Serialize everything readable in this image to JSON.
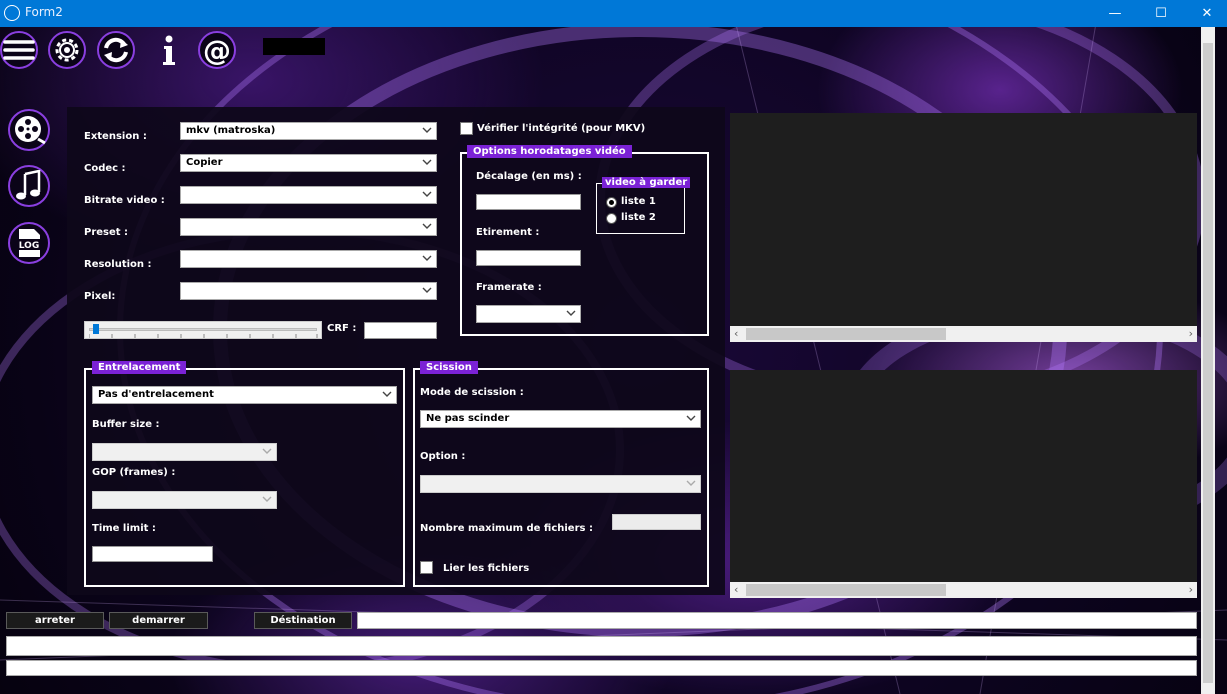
{
  "window": {
    "title": "Form2",
    "minimize": "—",
    "maximize": "☐",
    "close": "✕"
  },
  "toolbar": {
    "icons": [
      "menu-icon",
      "gear-icon",
      "refresh-icon",
      "info-icon",
      "at-icon"
    ]
  },
  "sidebar": {
    "icons": [
      "film-reel-icon",
      "music-note-icon",
      "log-icon"
    ],
    "log_text": "LOG"
  },
  "video": {
    "extension_label": "Extension :",
    "extension_value": "mkv (matroska)",
    "codec_label": "Codec :",
    "codec_value": "Copier",
    "bitrate_label": "Bitrate video :",
    "preset_label": "Preset :",
    "resolution_label": "Resolution :",
    "pixel_label": "Pixel:",
    "crf_label": "CRF :",
    "crf_slider_level": 0.02
  },
  "integrity": {
    "label": "Vérifier l'intégrité (pour MKV)",
    "checked": false
  },
  "timestamps": {
    "title": "Options horodatages vidéo",
    "offset_label": "Décalage (en ms) :",
    "stretch_label": "Etirement :",
    "framerate_label": "Framerate :",
    "keep": {
      "title": "video à garder",
      "options": [
        "liste 1",
        "liste 2"
      ],
      "selected": "liste 1"
    }
  },
  "interlace": {
    "title": "Entrelacement",
    "value": "Pas d'entrelacement",
    "buffer_label": "Buffer size :",
    "gop_label": "GOP (frames) :",
    "time_label": "Time limit :"
  },
  "split": {
    "title": "Scission",
    "mode_label": "Mode de scission :",
    "mode_value": "Ne pas scinder",
    "option_label": "Option :",
    "max_files_label": "Nombre maximum de fichiers :",
    "link_label": "Lier les fichiers",
    "link_checked": false
  },
  "actions": {
    "stop": "arreter",
    "start": "demarrer",
    "destination": "Déstination"
  },
  "colors": {
    "titlebar": "#0078d7",
    "accent": "#7b22d6",
    "panel": "#0e081a",
    "log_bg": "#1e1e1e"
  }
}
